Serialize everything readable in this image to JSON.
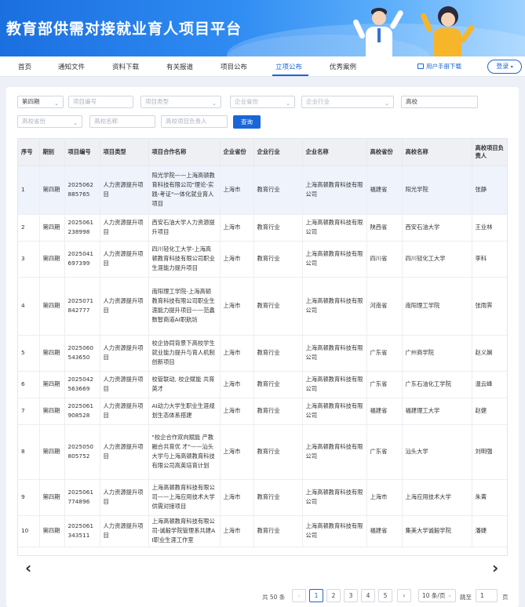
{
  "site": {
    "title": "教育部供需对接就业育人项目平台"
  },
  "nav": {
    "items": [
      "首页",
      "通知文件",
      "资料下载",
      "有关报道",
      "项目公布",
      "立项公布",
      "优秀案例"
    ],
    "manual": "用户手册下载",
    "login": "登录"
  },
  "filters": {
    "period": "第四期",
    "project_no_ph": "项目编号",
    "project_type_ph": "项目类型",
    "company_province_ph": "企业省份",
    "company_industry_ph": "企业行业",
    "school": "高校",
    "school_province_ph": "高校省份",
    "school_name_ph": "高校名称",
    "leader_ph": "高校项目负责人",
    "query": "查询"
  },
  "table": {
    "headers": [
      "序号",
      "期别",
      "项目编号",
      "项目类型",
      "项目合作名称",
      "企业省份",
      "企业行业",
      "企业名称",
      "高校省份",
      "高校名称",
      "高校项目负责人"
    ],
    "rows": [
      [
        "1",
        "第四期",
        "2025062885765",
        "人力资源提升项目",
        "阳光学院——上海高顿教育科技有限公司\"理论-实践-考证\"一体化就业育人项目",
        "上海市",
        "教育行业",
        "上海高顿教育科技有限公司",
        "福建省",
        "阳光学院",
        "张静"
      ],
      [
        "2",
        "第四期",
        "2025061238998",
        "人力资源提升项目",
        "西安石油大学人力资源提升项目",
        "上海市",
        "教育行业",
        "上海高顿教育科技有限公司",
        "陕西省",
        "西安石油大学",
        "王业林"
      ],
      [
        "3",
        "第四期",
        "2025041697399",
        "人力资源提升项目",
        "四川轻化工大学-上海高顿教育科技有限公司职业生涯能力提升项目",
        "上海市",
        "教育行业",
        "上海高顿教育科技有限公司",
        "四川省",
        "四川轻化工大学",
        "李科"
      ],
      [
        "4",
        "第四期",
        "2025071842777",
        "人力资源提升项目",
        "南阳理工学院-上海高顿教育科技有限公司职业生涯能力提升项目——范蠡数智商道AI职航坊",
        "上海市",
        "教育行业",
        "上海高顿教育科技有限公司",
        "河南省",
        "南阳理工学院",
        "张雨霁"
      ],
      [
        "5",
        "第四期",
        "2025060543650",
        "人力资源提升项目",
        "校企协同背景下高校学生就业能力提升与育人机制创新项目",
        "上海市",
        "教育行业",
        "上海高顿教育科技有限公司",
        "广东省",
        "广州商学院",
        "赵义娴"
      ],
      [
        "6",
        "第四期",
        "2025042563669",
        "人力资源提升项目",
        "校管联动, 校企赋能 共育英才",
        "上海市",
        "教育行业",
        "上海高顿教育科技有限公司",
        "广东省",
        "广东石油化工学院",
        "温云峰"
      ],
      [
        "7",
        "第四期",
        "2025061908528",
        "人力资源提升项目",
        "AI动力大学生职业生涯规划生态体系搭建",
        "上海市",
        "教育行业",
        "上海高顿教育科技有限公司",
        "福建省",
        "福建理工大学",
        "赵健"
      ],
      [
        "8",
        "第四期",
        "2025050805752",
        "人力资源提升项目",
        "\"校企合作双向赋能 产教融合共育优 才\"——汕头大学与上海高顿教育科技有限公司高英培育计划",
        "上海市",
        "教育行业",
        "上海高顿教育科技有限公司",
        "广东省",
        "汕头大学",
        "刘明强"
      ],
      [
        "9",
        "第四期",
        "2025061774896",
        "人力资源提升项目",
        "上海高顿教育科技有限公司——上海应用技术大学供需对接项目",
        "上海市",
        "教育行业",
        "上海高顿教育科技有限公司",
        "上海市",
        "上海应用技术大学",
        "朱菁"
      ],
      [
        "10",
        "第四期",
        "2025061343511",
        "人力资源提升项目",
        "上海高顿教育科技有限公司-诚毅学院管理系共建AI职业生涯工作室",
        "上海市",
        "教育行业",
        "上海高顿教育科技有限公司",
        "福建省",
        "集美大学诚毅学院",
        "潘婕"
      ]
    ]
  },
  "pagination": {
    "total": "共 50 条",
    "pages": [
      "1",
      "2",
      "3",
      "4",
      "5"
    ],
    "prev": "‹",
    "next": "›",
    "page_size": "10 条/页",
    "goto": "跳至",
    "current_input": "1",
    "unit": "页"
  }
}
